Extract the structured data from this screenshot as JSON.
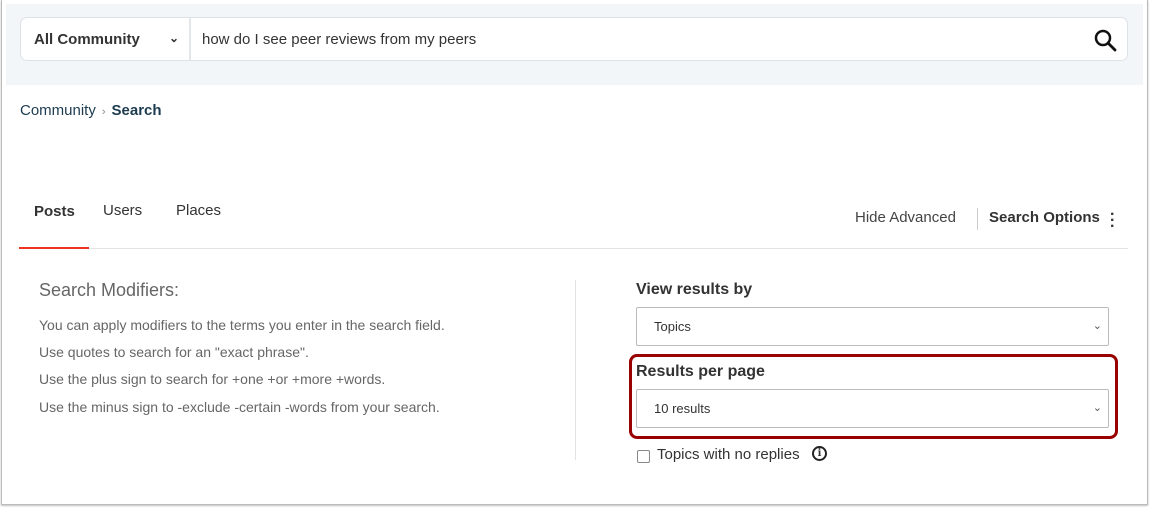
{
  "search": {
    "scope": "All Community",
    "query": "how do I see peer reviews from my peers"
  },
  "breadcrumb": {
    "items": [
      "Community",
      "Search"
    ],
    "separator": "›"
  },
  "tabs": [
    "Posts",
    "Users",
    "Places"
  ],
  "options": {
    "hide_advanced": "Hide Advanced",
    "search_options": "Search Options"
  },
  "modifiers": {
    "title": "Search Modifiers:",
    "lines": [
      "You can apply modifiers to the terms you enter in the search field.",
      "Use quotes to search for an \"exact phrase\".",
      "Use the plus sign to search for +one +or +more +words.",
      "Use the minus sign to -exclude -certain -words from your search."
    ]
  },
  "view_results": {
    "label": "View results by",
    "value": "Topics"
  },
  "results_per_page": {
    "label": "Results per page",
    "value": "10 results"
  },
  "no_replies": {
    "label": "Topics with no replies",
    "checked": false
  },
  "colors": {
    "highlight": "#990000",
    "tab_accent": "#ee3322"
  }
}
